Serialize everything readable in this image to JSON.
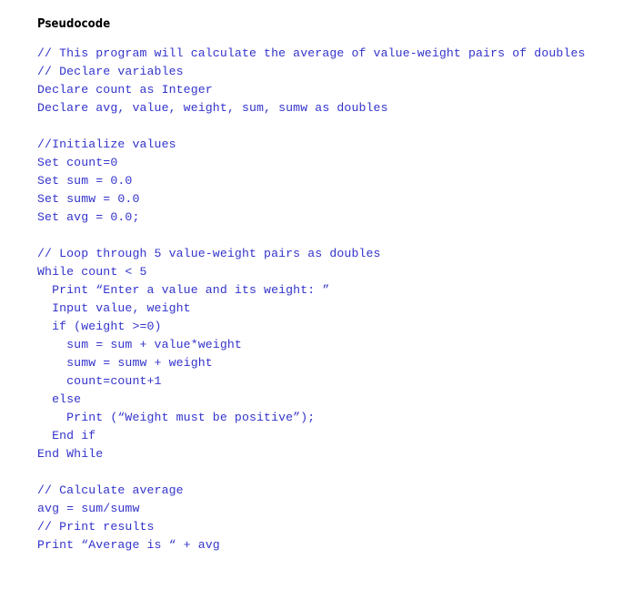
{
  "document": {
    "heading": "Pseudocode",
    "code_color": "#3333CC",
    "heading_color": "#000000",
    "background_color": "#FFFFFF"
  },
  "code": {
    "language_label": "pseudocode",
    "lines": [
      "// This program will calculate the average of value-weight pairs of doubles",
      "// Declare variables",
      "Declare count as Integer",
      "Declare avg, value, weight, sum, sumw as doubles",
      "",
      "//Initialize values",
      "Set count=0",
      "Set sum = 0.0",
      "Set sumw = 0.0",
      "Set avg = 0.0;",
      "",
      "// Loop through 5 value-weight pairs as doubles",
      "While count < 5",
      "  Print “Enter a value and its weight: ”",
      "  Input value, weight",
      "  if (weight >=0)",
      "    sum = sum + value*weight",
      "    sumw = sumw + weight",
      "    count=count+1",
      "  else",
      "    Print (“Weight must be positive”);",
      "  End if",
      "End While",
      "",
      "// Calculate average",
      "avg = sum/sumw",
      "// Print results",
      "Print “Average is “ + avg"
    ]
  }
}
